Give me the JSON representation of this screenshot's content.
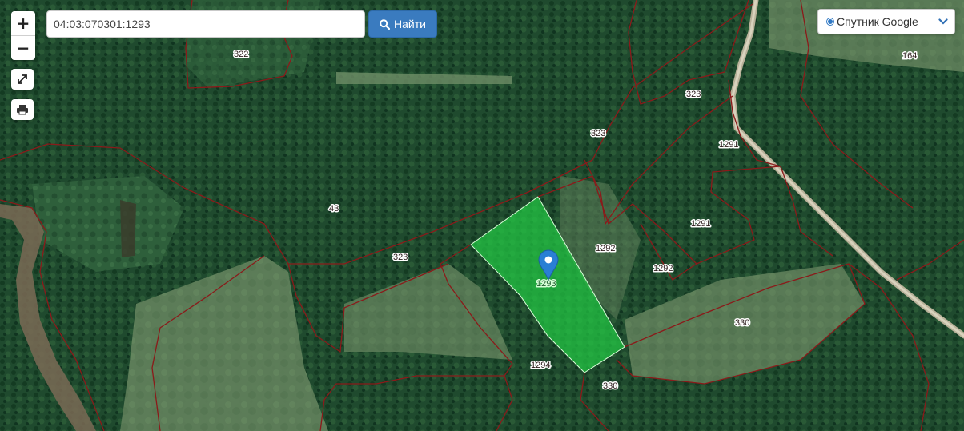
{
  "search": {
    "value": "04:03:070301:1293",
    "button_label": "Найти"
  },
  "zoom": {
    "in_label": "+",
    "out_label": "−"
  },
  "layer": {
    "selected": "Спутник Google"
  },
  "parcels": {
    "p322": "322",
    "p164": "164",
    "p323a": "323",
    "p323b": "323",
    "p323c": "323",
    "p1291a": "1291",
    "p1291b": "1291",
    "p43": "43",
    "p1292a": "1292",
    "p1292b": "1292",
    "p1293": "1293",
    "p330a": "330",
    "p330b": "330",
    "p1294": "1294"
  },
  "colors": {
    "boundary": "#8b1a1a",
    "selected_fill": "#22cc44",
    "marker": "#2a7fd4",
    "search_button": "#3a7bbf"
  },
  "icons": {
    "search": "search-icon",
    "fullscreen": "fullscreen-icon",
    "print": "print-icon",
    "marker": "map-marker-icon",
    "dropdown": "chevron-down-icon"
  }
}
